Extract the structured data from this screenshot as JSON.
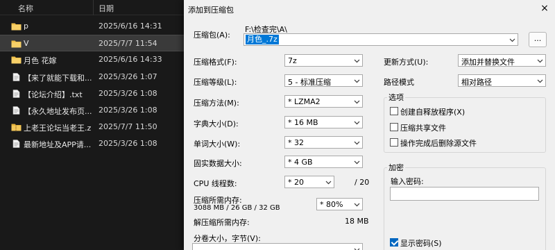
{
  "explorer": {
    "header": {
      "name": "名称",
      "date": "日期"
    },
    "rows": [
      {
        "name": "p",
        "date": "2025/6/16 14:31",
        "type": "folder"
      },
      {
        "name": "V",
        "date": "2025/7/7 11:54",
        "type": "folder",
        "selected": true
      },
      {
        "name": "月色 花嫁",
        "date": "2025/6/16 14:33",
        "type": "folder"
      },
      {
        "name": "【来了就能下载和...",
        "date": "2025/3/26 1:07",
        "type": "file"
      },
      {
        "name": "【论坛介绍】.txt",
        "date": "2025/3/26 1:08",
        "type": "file"
      },
      {
        "name": "【永久地址发布页...",
        "date": "2025/3/26 1:08",
        "type": "file"
      },
      {
        "name": "上老王论坛当老王.z...",
        "date": "2025/7/7 11:50",
        "type": "archive"
      },
      {
        "name": "最新地址及APP请...",
        "date": "2025/3/26 1:08",
        "type": "file"
      }
    ]
  },
  "dialog": {
    "title": "添加到压缩包",
    "close": "×",
    "archive_label": "压缩包(A):",
    "archive_path": "F:\\检查完\\A\\",
    "archive_name": "月色_.7z",
    "browse_label": "...",
    "format_label": "压缩格式(F):",
    "format_value": "7z",
    "level_label": "压缩等级(L):",
    "level_value": "5 - 标准压缩",
    "method_label": "压缩方法(M):",
    "method_value": "* LZMA2",
    "dict_label": "字典大小(D):",
    "dict_value": "* 16 MB",
    "word_label": "单词大小(W):",
    "word_value": "* 32",
    "solid_label": "固实数据大小:",
    "solid_value": "* 4 GB",
    "cpu_label": "CPU 线程数:",
    "cpu_value": "* 20",
    "cpu_total": "/ 20",
    "mem_label": "压缩所需内存:",
    "mem_info": "3088 MB / 26 GB / 32 GB",
    "mem_value": "* 80%",
    "decomp_label": "解压缩所需内存:",
    "decomp_value": "18 MB",
    "split_label": "分卷大小，字节(V):",
    "split_value": "",
    "update_label": "更新方式(U):",
    "update_value": "添加并替换文件",
    "pathmode_label": "路径模式",
    "pathmode_value": "相对路径",
    "options_title": "选项",
    "opt_sfx": "创建自释放程序(X)",
    "opt_shared": "压缩共享文件",
    "opt_delete": "操作完成后删除源文件",
    "encrypt_title": "加密",
    "password_label": "输入密码:",
    "password_value": "",
    "show_password": "显示密码(S)"
  }
}
